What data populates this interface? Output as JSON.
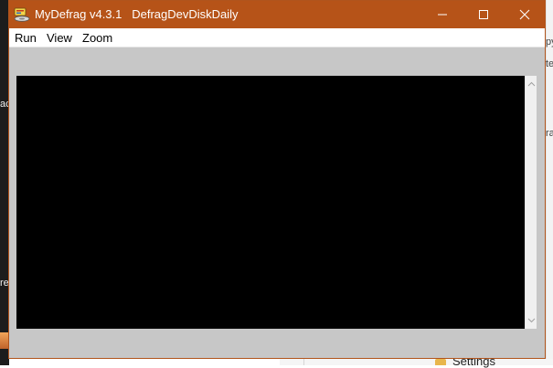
{
  "window": {
    "app_name": "MyDefrag v4.3.1",
    "script_name": "DefragDevDiskDaily",
    "accent_color": "#b65318"
  },
  "menu": {
    "items": [
      "Run",
      "View",
      "Zoom"
    ]
  },
  "background": {
    "right_fragments": [
      "py",
      "te",
      "ra"
    ],
    "left_fragments": [
      "ac",
      "re"
    ],
    "taskbar_label": "Settings"
  },
  "icons": {
    "app": "mydefrag-app-icon",
    "minimize": "minimize-icon",
    "maximize": "maximize-icon",
    "close": "close-icon",
    "scroll_up": "chevron-up-icon",
    "scroll_down": "chevron-down-icon",
    "folder": "folder-icon"
  }
}
